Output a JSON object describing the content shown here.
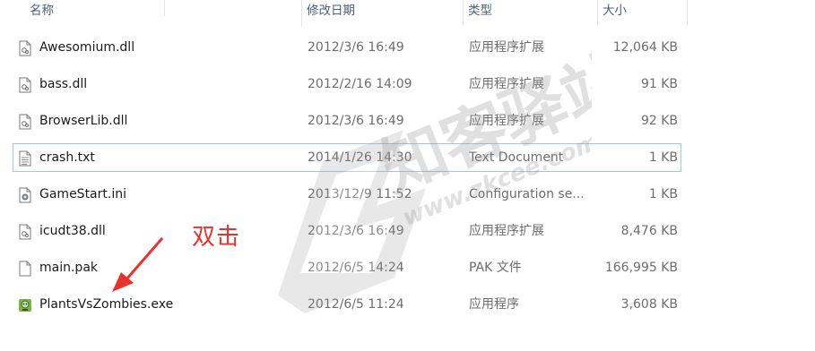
{
  "columns": {
    "name": "名称",
    "date": "修改日期",
    "type": "类型",
    "size": "大小"
  },
  "files": [
    {
      "name": "Awesomium.dll",
      "date": "2012/3/6 16:49",
      "type": "应用程序扩展",
      "size": "12,064 KB",
      "icon": "dll-file-icon"
    },
    {
      "name": "bass.dll",
      "date": "2012/2/16 14:09",
      "type": "应用程序扩展",
      "size": "91 KB",
      "icon": "dll-file-icon"
    },
    {
      "name": "BrowserLib.dll",
      "date": "2012/3/6 16:49",
      "type": "应用程序扩展",
      "size": "92 KB",
      "icon": "dll-file-icon"
    },
    {
      "name": "crash.txt",
      "date": "2014/1/26 14:30",
      "type": "Text Document",
      "size": "1 KB",
      "icon": "text-file-icon"
    },
    {
      "name": "GameStart.ini",
      "date": "2013/12/9 11:52",
      "type": "Configuration se...",
      "size": "1 KB",
      "icon": "settings-file-icon"
    },
    {
      "name": "icudt38.dll",
      "date": "2012/3/6 16:49",
      "type": "应用程序扩展",
      "size": "8,476 KB",
      "icon": "dll-file-icon"
    },
    {
      "name": "main.pak",
      "date": "2012/6/5 14:24",
      "type": "PAK 文件",
      "size": "166,995 KB",
      "icon": "blank-file-icon"
    },
    {
      "name": "PlantsVsZombies.exe",
      "date": "2012/6/5 11:24",
      "type": "应用程序",
      "size": "3,608 KB",
      "icon": "pvz-app-icon"
    }
  ],
  "annotation": {
    "text": "双击",
    "color": "#e8322a"
  },
  "watermark": {
    "brand": "知客驿站",
    "url": "www.zkcee.com"
  },
  "colors": {
    "header_text": "#4c607a",
    "selection_border": "#99c9f0",
    "secondary_text": "#6d6d6d"
  }
}
